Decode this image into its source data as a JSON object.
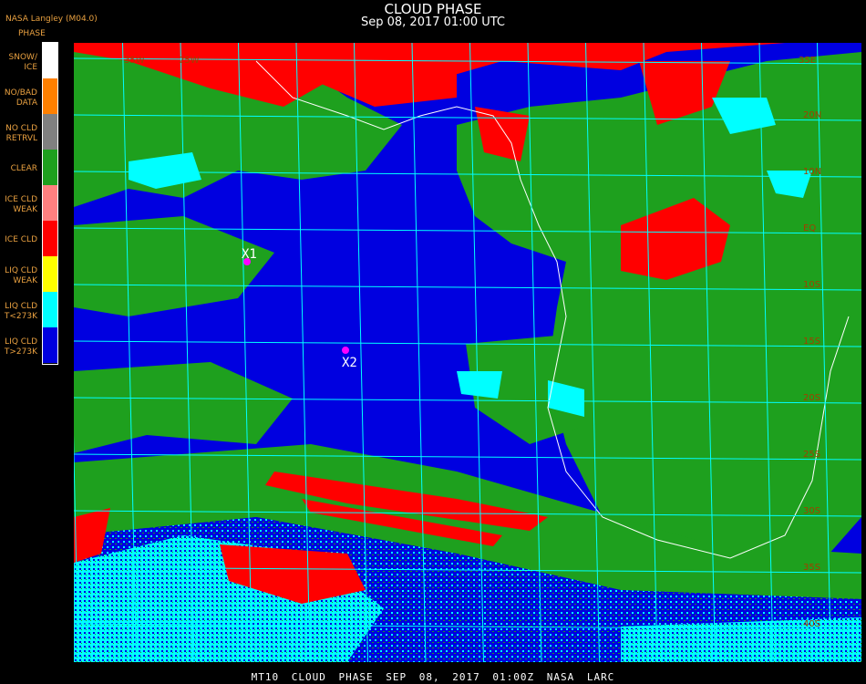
{
  "header": {
    "title": "CLOUD PHASE",
    "subtitle": "Sep 08, 2017 01:00 UTC",
    "provider": "NASA Langley (M04.0)"
  },
  "legend": {
    "heading": "PHASE",
    "items": [
      {
        "label": "SNOW/\nICE",
        "color": "#ffffff"
      },
      {
        "label": "NO/BAD\nDATA",
        "color": "#ff8000"
      },
      {
        "label": "NO CLD\nRETRVL",
        "color": "#808080"
      },
      {
        "label": "CLEAR",
        "color": "#1ea01e"
      },
      {
        "label": "ICE CLD\nWEAK",
        "color": "#ff8080"
      },
      {
        "label": "ICE CLD",
        "color": "#ff0000"
      },
      {
        "label": "LIQ CLD\nWEAK",
        "color": "#ffff00"
      },
      {
        "label": "LIQ CLD\nT<273K",
        "color": "#00ffff"
      },
      {
        "label": "LIQ CLD\nT>273K",
        "color": "#0000e0"
      }
    ]
  },
  "map": {
    "markers": [
      {
        "label": "X1",
        "color": "#ff00ff"
      },
      {
        "label": "X2",
        "color": "#ff00ff"
      }
    ],
    "grid_labels_top": [
      "35W",
      "25W",
      "35E"
    ],
    "grid_labels_right": [
      "20N",
      "10N",
      "EQ",
      "10S",
      "15S",
      "20S",
      "25S",
      "30S",
      "35S",
      "40S"
    ]
  },
  "footer": {
    "text": "MT10  CLOUD PHASE  SEP 08, 2017 01:00Z  NASA LARC"
  }
}
